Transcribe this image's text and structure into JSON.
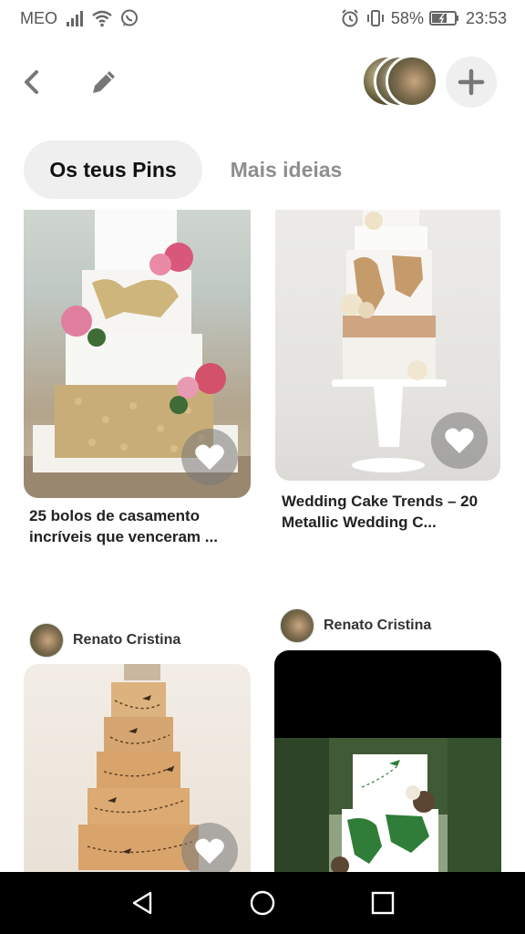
{
  "status_bar": {
    "carrier": "MEO",
    "battery_percent": "58%",
    "time": "23:53",
    "icons": [
      "signal-icon",
      "wifi-icon",
      "whatsapp-icon",
      "alarm-icon",
      "vibrate-icon",
      "battery-icon"
    ]
  },
  "header": {
    "back_icon": "chevron-left-icon",
    "edit_icon": "pencil-icon",
    "add_icon": "plus-icon"
  },
  "tabs": [
    {
      "label": "Os teus Pins",
      "active": true
    },
    {
      "label": "Mais ideias",
      "active": false
    }
  ],
  "pins": [
    {
      "title": "25 bolos de casamento incríveis que venceram ...",
      "image": "tiered-cake-pink-roses-gold-map"
    },
    {
      "title": "Wedding Cake Trends – 20 Metallic Wedding C...",
      "image": "white-cake-copper-map-stand"
    },
    {
      "author": "Renato Cristina",
      "image": "orange-cake-airplanes"
    },
    {
      "author": "Renato Cristina",
      "image": "white-cake-green-map"
    }
  ],
  "navbar": {
    "icons": [
      "back-triangle-icon",
      "home-circle-icon",
      "recents-square-icon"
    ]
  },
  "colors": {
    "tab_active_bg": "#efefef",
    "tab_inactive_text": "#8e8e8e",
    "navbar_bg": "#000000"
  }
}
